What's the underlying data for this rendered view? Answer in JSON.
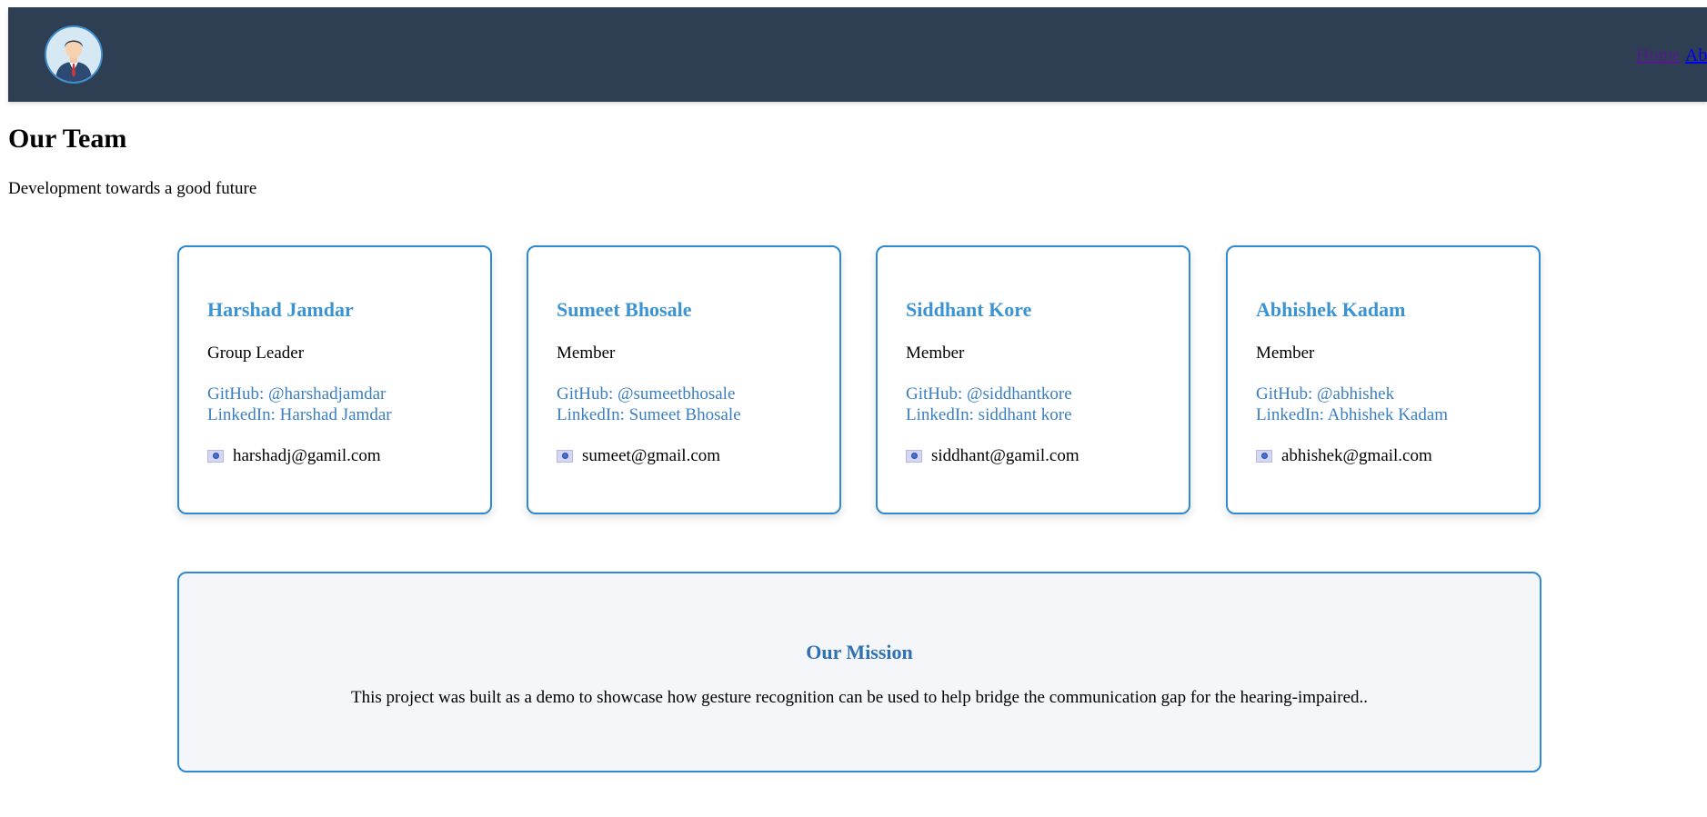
{
  "nav": {
    "home_label": "Home",
    "about_label": "About"
  },
  "header": {
    "title": "Our Team",
    "subtitle": "Development towards a good future"
  },
  "team": [
    {
      "name": "Harshad Jamdar",
      "role": "Group Leader",
      "github": "GitHub: @harshadjamdar",
      "linkedin": "LinkedIn: Harshad Jamdar",
      "email": "harshadj@gamil.com"
    },
    {
      "name": "Sumeet Bhosale",
      "role": "Member",
      "github": "GitHub: @sumeetbhosale",
      "linkedin": "LinkedIn: Sumeet Bhosale",
      "email": "sumeet@gmail.com"
    },
    {
      "name": "Siddhant Kore",
      "role": "Member",
      "github": "GitHub: @siddhantkore",
      "linkedin": "LinkedIn: siddhant kore",
      "email": "siddhant@gamil.com"
    },
    {
      "name": "Abhishek Kadam",
      "role": "Member",
      "github": "GitHub: @abhishek",
      "linkedin": "LinkedIn: Abhishek Kadam",
      "email": "abhishek@gmail.com"
    }
  ],
  "mission": {
    "title": "Our Mission",
    "text": "This project was built as a demo to showcase how gesture recognition can be used to help bridge the communication gap for the hearing-impaired.."
  },
  "colors": {
    "header_bg": "#2e3f53",
    "card_border": "#2f8ad6",
    "name_color": "#3c93d1",
    "link_color": "#3a7fc1",
    "mission_bg": "#f4f6f9"
  }
}
